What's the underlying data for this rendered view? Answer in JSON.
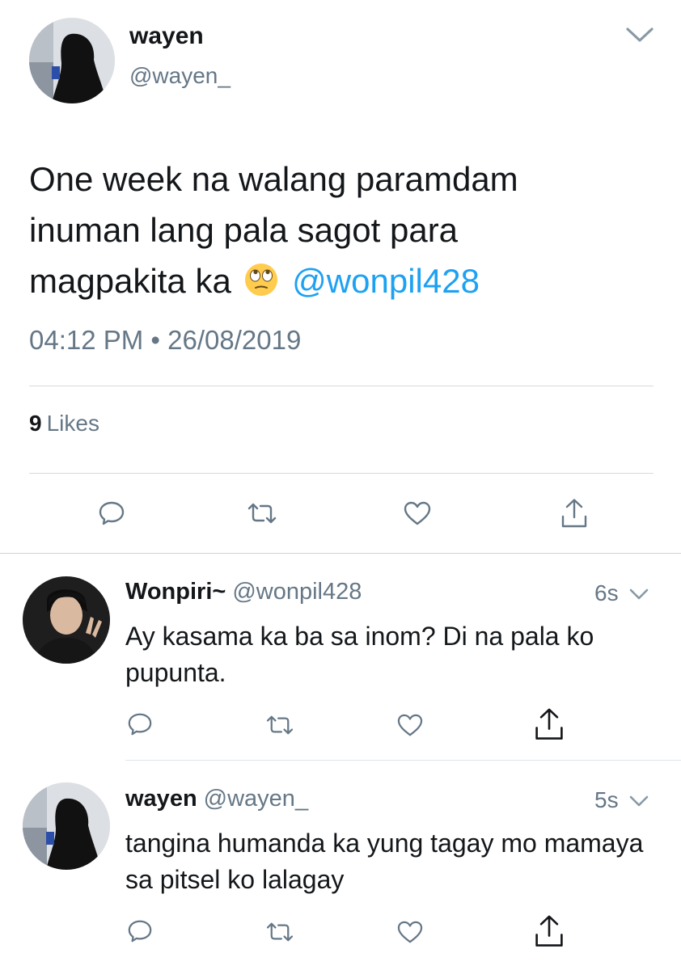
{
  "main_tweet": {
    "author_name": "wayen",
    "author_handle": "@wayen_",
    "text_lines": [
      "One week na walang paramdam",
      "inuman lang pala sagot para",
      "magpakita ka"
    ],
    "emoji": "face-with-rolling-eyes",
    "mention": "@wonpil428",
    "timestamp": "04:12 PM • 26/08/2019",
    "likes_count": "9",
    "likes_label": "Likes"
  },
  "replies": [
    {
      "author_name": "Wonpiri~",
      "author_handle": "@wonpil428",
      "time": "6s",
      "text": "Ay kasama ka ba sa inom? Di na pala ko pupunta."
    },
    {
      "author_name": "wayen",
      "author_handle": "@wayen_",
      "time": "5s",
      "text": "tangina humanda ka yung tagay mo mamaya sa pitsel ko lalagay"
    }
  ],
  "icons": {
    "reply": "reply-icon",
    "retweet": "retweet-icon",
    "like": "heart-icon",
    "share": "share-icon",
    "more": "chevron-down-icon"
  },
  "colors": {
    "text": "#14171a",
    "secondary": "#657786",
    "accent": "#1da1f2",
    "divider": "#d9d9d9"
  }
}
